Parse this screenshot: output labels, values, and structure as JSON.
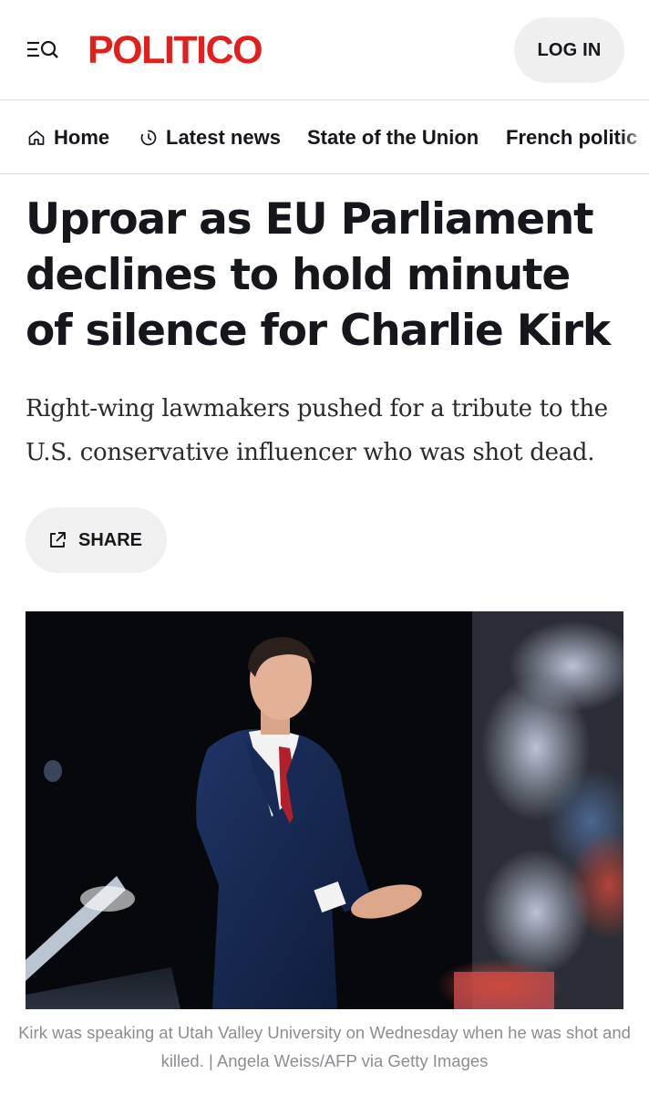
{
  "header": {
    "logo_text": "POLITICO",
    "login_label": "LOG IN",
    "menu_icon": "menu-search-icon",
    "brand_color": "#e1201e"
  },
  "nav": {
    "items": [
      {
        "label": "Home",
        "icon": "home-icon"
      },
      {
        "label": "Latest news",
        "icon": "clock-icon"
      },
      {
        "label": "State of the Union"
      },
      {
        "label": "French politic"
      }
    ]
  },
  "article": {
    "headline": "Uproar as EU Parliament declines to hold minute of silence for Charlie Kirk",
    "dek": "Right-wing lawmakers pushed for a tribute to the U.S. conservative influencer who was shot dead.",
    "share_label": "SHARE",
    "share_icon": "share-icon",
    "caption": "Kirk was speaking at Utah Valley University on Wednesday when he was shot and killed. | Angela Weiss/AFP via Getty Images"
  }
}
